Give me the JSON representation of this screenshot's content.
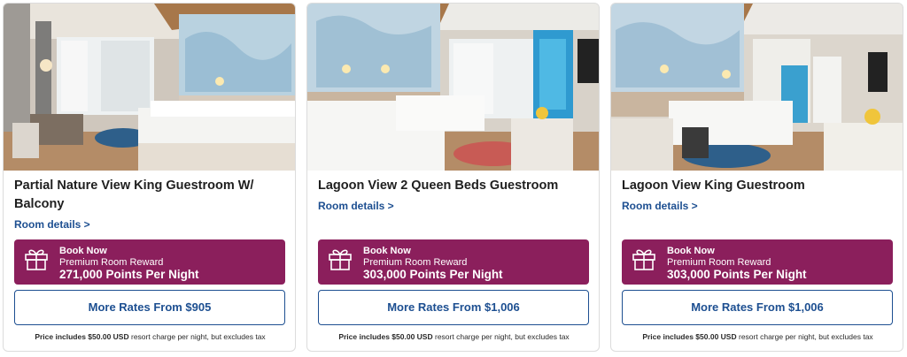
{
  "cards": [
    {
      "title": "Partial Nature View King Guestroom W/ Balcony",
      "details_link": "Room details >",
      "reward": {
        "line1": "Book Now",
        "line2": "Premium Room Reward",
        "line3": "271,000 Points Per Night"
      },
      "rates_button": "More Rates From $905",
      "price_note_bold": "Price includes $50.00 USD",
      "price_note_rest": "resort charge per night, but excludes tax"
    },
    {
      "title": "Lagoon View 2 Queen Beds Guestroom",
      "details_link": "Room details >",
      "reward": {
        "line1": "Book Now",
        "line2": "Premium Room Reward",
        "line3": "303,000 Points Per Night"
      },
      "rates_button": "More Rates From $1,006",
      "price_note_bold": "Price includes $50.00 USD",
      "price_note_rest": "resort charge per night, but excludes tax"
    },
    {
      "title": "Lagoon View King Guestroom",
      "details_link": "Room details >",
      "reward": {
        "line1": "Book Now",
        "line2": "Premium Room Reward",
        "line3": "303,000 Points Per Night"
      },
      "rates_button": "More Rates From $1,006",
      "price_note_bold": "Price includes $50.00 USD",
      "price_note_rest": "resort charge per night, but excludes tax"
    }
  ],
  "colors": {
    "reward_bg": "#8b1f5c",
    "link_blue": "#1d4f91"
  },
  "icons": {
    "reward": "gift-icon"
  }
}
